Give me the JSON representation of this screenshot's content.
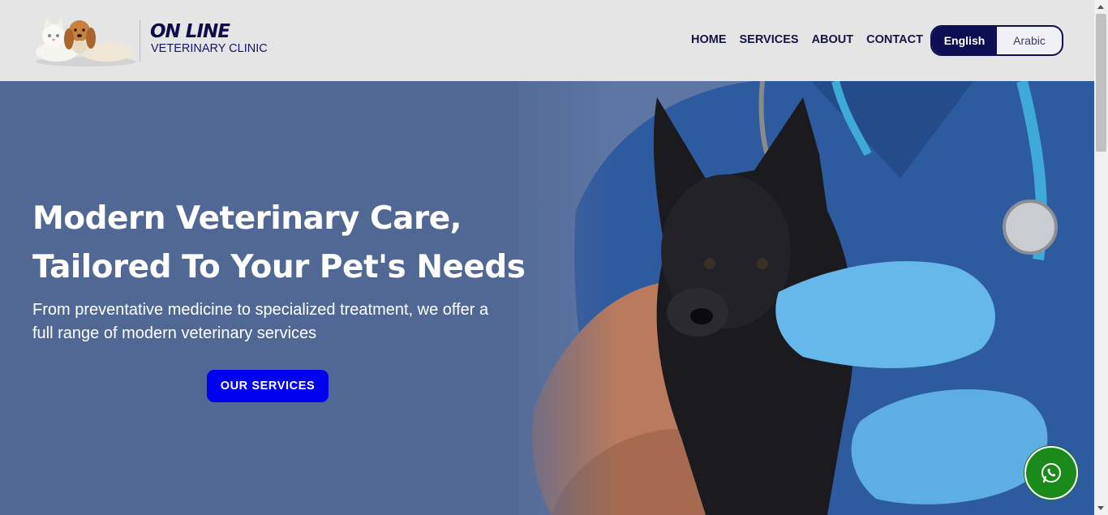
{
  "brand": {
    "title": "ON LINE",
    "subtitle": "VETERINARY CLINIC"
  },
  "nav": {
    "items": [
      {
        "label": "HOME"
      },
      {
        "label": "SERVICES"
      },
      {
        "label": "ABOUT"
      },
      {
        "label": "CONTACT"
      }
    ]
  },
  "language": {
    "options": [
      "English",
      "Arabic"
    ],
    "selected": "English"
  },
  "hero": {
    "title_line1": "Modern Veterinary Care,",
    "title_line2": "Tailored To Your Pet's Needs",
    "subtitle": "From preventative medicine to specialized treatment, we offer a full range of modern veterinary services",
    "cta_label": "OUR SERVICES"
  },
  "icons": {
    "chat": "whatsapp-icon"
  },
  "colors": {
    "header_bg": "#e5e5e5",
    "navy": "#0e0e55",
    "hero_bg": "#526894",
    "cta": "#0000ee",
    "whatsapp": "#1b8a1b"
  }
}
